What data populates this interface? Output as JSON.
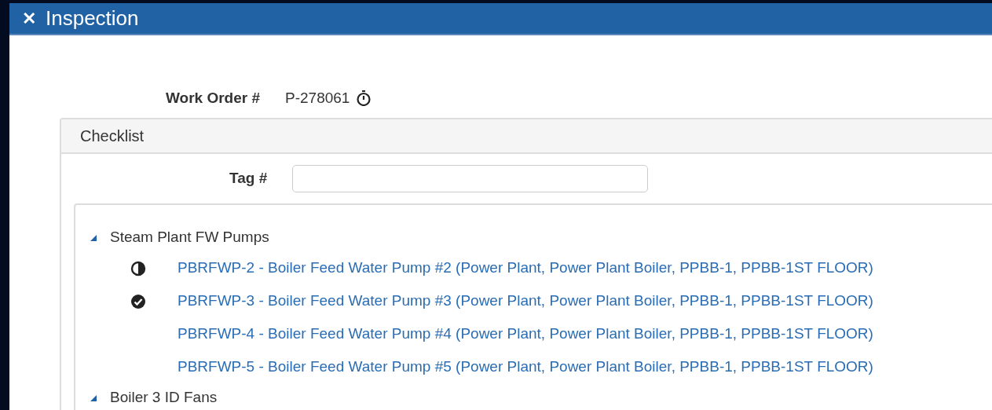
{
  "window": {
    "title": "Inspection",
    "close_glyph": "✕"
  },
  "work_order": {
    "label": "Work Order #",
    "value": "P-278061"
  },
  "checklist": {
    "title": "Checklist",
    "tag_field": {
      "label": "Tag #"
    },
    "groups": [
      {
        "label": "Steam Plant FW Pumps",
        "expanded": true,
        "children": [
          {
            "label": "PBRFWP-2 - Boiler Feed Water Pump #2 (Power Plant, Power Plant Boiler, PPBB-1, PPBB-1ST FLOOR)",
            "kind": "partial"
          },
          {
            "label": "PBRFWP-3 - Boiler Feed Water Pump #3 (Power Plant, Power Plant Boiler, PPBB-1, PPBB-1ST FLOOR)",
            "kind": "complete"
          },
          {
            "label": "PBRFWP-4 - Boiler Feed Water Pump #4 (Power Plant, Power Plant Boiler, PPBB-1, PPBB-1ST FLOOR)",
            "kind": "plain"
          },
          {
            "label": "PBRFWP-5 - Boiler Feed Water Pump #5 (Power Plant, Power Plant Boiler, PPBB-1, PPBB-1ST FLOOR)",
            "kind": "plain"
          }
        ]
      },
      {
        "label": "Boiler 3 ID Fans",
        "expanded": true
      }
    ]
  }
}
